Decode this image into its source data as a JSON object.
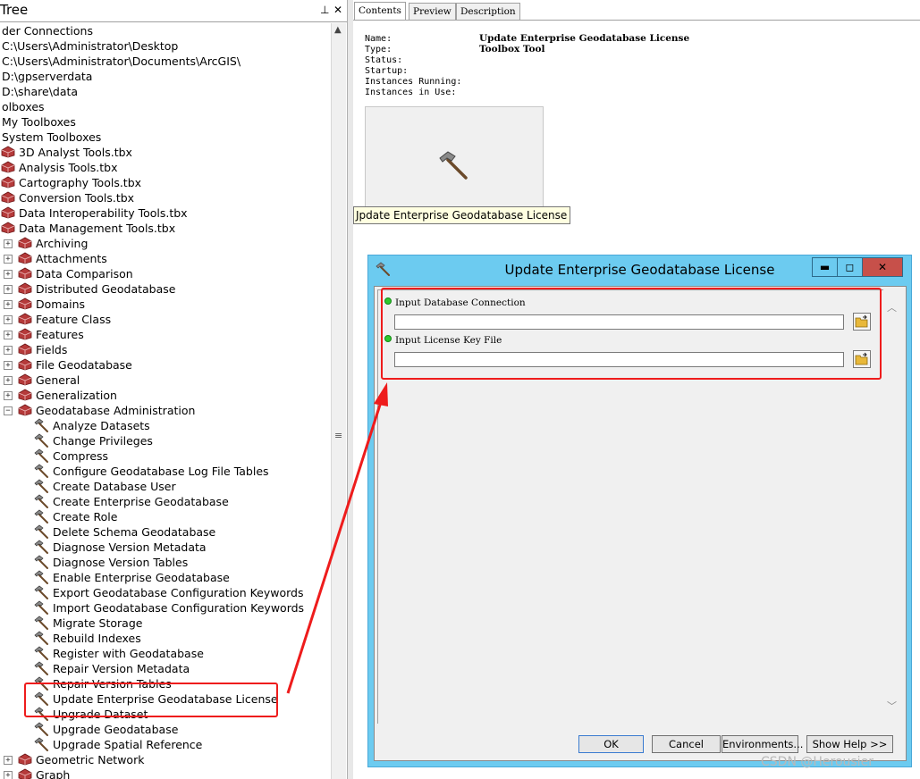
{
  "tree": {
    "title": "Tree",
    "pin_glyph": "⊥",
    "close_glyph": "✕",
    "rows": [
      {
        "text": "der Connections",
        "indent": 0
      },
      {
        "text": "C:\\Users\\Administrator\\Desktop",
        "indent": 0
      },
      {
        "text": "C:\\Users\\Administrator\\Documents\\ArcGIS\\",
        "indent": 0
      },
      {
        "text": "D:\\gpserverdata",
        "indent": 0
      },
      {
        "text": "D:\\share\\data",
        "indent": 0
      },
      {
        "text": "olboxes",
        "indent": 0
      },
      {
        "text": "My Toolboxes",
        "indent": 0
      },
      {
        "text": "System Toolboxes",
        "indent": 0
      },
      {
        "text": "3D Analyst Tools.tbx",
        "indent": 1,
        "icon": "toolbox"
      },
      {
        "text": "Analysis Tools.tbx",
        "indent": 1,
        "icon": "toolbox"
      },
      {
        "text": "Cartography Tools.tbx",
        "indent": 1,
        "icon": "toolbox"
      },
      {
        "text": "Conversion Tools.tbx",
        "indent": 1,
        "icon": "toolbox"
      },
      {
        "text": "Data Interoperability Tools.tbx",
        "indent": 1,
        "icon": "toolbox"
      },
      {
        "text": "Data Management Tools.tbx",
        "indent": 1,
        "icon": "toolbox"
      },
      {
        "text": "Archiving",
        "indent": 2,
        "icon": "toolset",
        "expander": "+"
      },
      {
        "text": "Attachments",
        "indent": 2,
        "icon": "toolset",
        "expander": "+"
      },
      {
        "text": "Data Comparison",
        "indent": 2,
        "icon": "toolset",
        "expander": "+"
      },
      {
        "text": "Distributed Geodatabase",
        "indent": 2,
        "icon": "toolset",
        "expander": "+"
      },
      {
        "text": "Domains",
        "indent": 2,
        "icon": "toolset",
        "expander": "+"
      },
      {
        "text": "Feature Class",
        "indent": 2,
        "icon": "toolset",
        "expander": "+"
      },
      {
        "text": "Features",
        "indent": 2,
        "icon": "toolset",
        "expander": "+"
      },
      {
        "text": "Fields",
        "indent": 2,
        "icon": "toolset",
        "expander": "+"
      },
      {
        "text": "File Geodatabase",
        "indent": 2,
        "icon": "toolset",
        "expander": "+"
      },
      {
        "text": "General",
        "indent": 2,
        "icon": "toolset",
        "expander": "+"
      },
      {
        "text": "Generalization",
        "indent": 2,
        "icon": "toolset",
        "expander": "+"
      },
      {
        "text": "Geodatabase Administration",
        "indent": 2,
        "icon": "toolset",
        "expander": "−"
      },
      {
        "text": "Analyze Datasets",
        "indent": 3,
        "icon": "hammer"
      },
      {
        "text": "Change Privileges",
        "indent": 3,
        "icon": "hammer"
      },
      {
        "text": "Compress",
        "indent": 3,
        "icon": "hammer"
      },
      {
        "text": "Configure Geodatabase Log File Tables",
        "indent": 3,
        "icon": "hammer"
      },
      {
        "text": "Create Database User",
        "indent": 3,
        "icon": "hammer"
      },
      {
        "text": "Create Enterprise Geodatabase",
        "indent": 3,
        "icon": "hammer"
      },
      {
        "text": "Create Role",
        "indent": 3,
        "icon": "hammer"
      },
      {
        "text": "Delete Schema Geodatabase",
        "indent": 3,
        "icon": "hammer"
      },
      {
        "text": "Diagnose Version Metadata",
        "indent": 3,
        "icon": "hammer"
      },
      {
        "text": "Diagnose Version Tables",
        "indent": 3,
        "icon": "hammer"
      },
      {
        "text": "Enable Enterprise Geodatabase",
        "indent": 3,
        "icon": "hammer"
      },
      {
        "text": "Export Geodatabase Configuration Keywords",
        "indent": 3,
        "icon": "hammer"
      },
      {
        "text": "Import Geodatabase Configuration Keywords",
        "indent": 3,
        "icon": "hammer"
      },
      {
        "text": "Migrate Storage",
        "indent": 3,
        "icon": "hammer"
      },
      {
        "text": "Rebuild Indexes",
        "indent": 3,
        "icon": "hammer"
      },
      {
        "text": "Register with Geodatabase",
        "indent": 3,
        "icon": "hammer"
      },
      {
        "text": "Repair Version Metadata",
        "indent": 3,
        "icon": "hammer"
      },
      {
        "text": "Repair Version Tables",
        "indent": 3,
        "icon": "hammer"
      },
      {
        "text": "Update Enterprise Geodatabase License",
        "indent": 3,
        "icon": "hammer",
        "selected": true
      },
      {
        "text": "Upgrade Dataset",
        "indent": 3,
        "icon": "hammer"
      },
      {
        "text": "Upgrade Geodatabase",
        "indent": 3,
        "icon": "hammer"
      },
      {
        "text": "Upgrade Spatial Reference",
        "indent": 3,
        "icon": "hammer"
      },
      {
        "text": "Geometric Network",
        "indent": 2,
        "icon": "toolset",
        "expander": "+"
      },
      {
        "text": "Graph",
        "indent": 2,
        "icon": "toolset",
        "expander": "+"
      }
    ]
  },
  "right": {
    "tabs": [
      "Contents",
      "Preview",
      "Description"
    ],
    "active_tab": 0,
    "info": [
      {
        "label": "Name:",
        "value": "Update Enterprise Geodatabase License"
      },
      {
        "label": "Type:",
        "value": "Toolbox Tool"
      },
      {
        "label": "Status:",
        "value": ""
      },
      {
        "label": "Startup:",
        "value": ""
      },
      {
        "label": "Instances Running:",
        "value": ""
      },
      {
        "label": "Instances in Use:",
        "value": ""
      }
    ],
    "tooltip": "Jpdate Enterprise Geodatabase License"
  },
  "dialog": {
    "title": "Update Enterprise Geodatabase License",
    "minimize": "▬",
    "maximize": "◻",
    "close": "✕",
    "params": [
      {
        "label": "Input Database Connection",
        "value": ""
      },
      {
        "label": "Input License Key File",
        "value": ""
      }
    ],
    "buttons": {
      "ok": "OK",
      "cancel": "Cancel",
      "environments": "Environments...",
      "show_help": "Show Help >>"
    }
  },
  "watermark": "CSDN @Herousier",
  "colors": {
    "annotation_red": "#ee1c1c",
    "dialog_frame": "#6ccbf0",
    "close_button": "#c7504a"
  }
}
